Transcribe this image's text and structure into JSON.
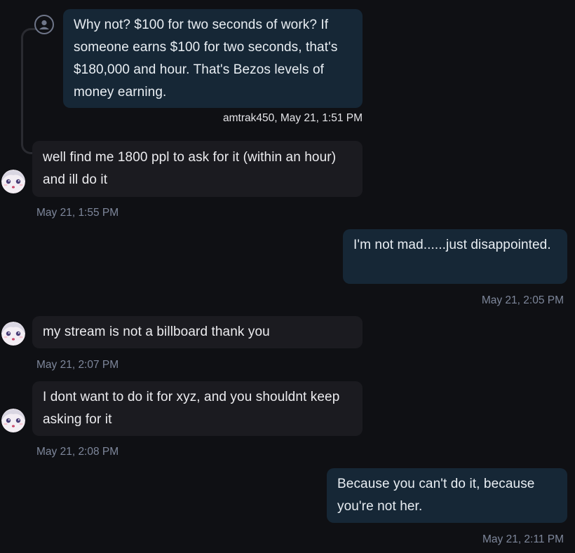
{
  "messages": [
    {
      "id": "m1",
      "side": "quoted",
      "text": "Why not? $100 for two seconds of work? If someone earns $100 for two seconds, that's $180,000 and hour. That's Bezos levels of money earning.",
      "meta": "amtrak450, May 21, 1:51 PM"
    },
    {
      "id": "m2",
      "side": "them",
      "text": "well find me 1800 ppl to ask for it (within an hour) and ill do it",
      "meta": "May 21, 1:55 PM"
    },
    {
      "id": "m3",
      "side": "me",
      "text": "I'm not mad......just disappointed.",
      "meta": "May 21, 2:05 PM"
    },
    {
      "id": "m4",
      "side": "them",
      "text": "my stream is not a billboard thank you",
      "meta": "May 21, 2:07 PM"
    },
    {
      "id": "m5",
      "side": "them",
      "text": "I dont want to do it for xyz, and you shouldnt keep asking for it",
      "meta": "May 21, 2:08 PM"
    },
    {
      "id": "m6",
      "side": "me",
      "text": "Because you can't do it, because you're not her.",
      "meta": "May 21, 2:11 PM"
    }
  ],
  "icons": {
    "quoted_user": "user-icon",
    "them_avatar": "anime-avatar-icon"
  },
  "colors": {
    "background": "#0f1014",
    "bubble_them": "#1b1b20",
    "bubble_me": "#162736",
    "timestamp": "#7e879b"
  }
}
